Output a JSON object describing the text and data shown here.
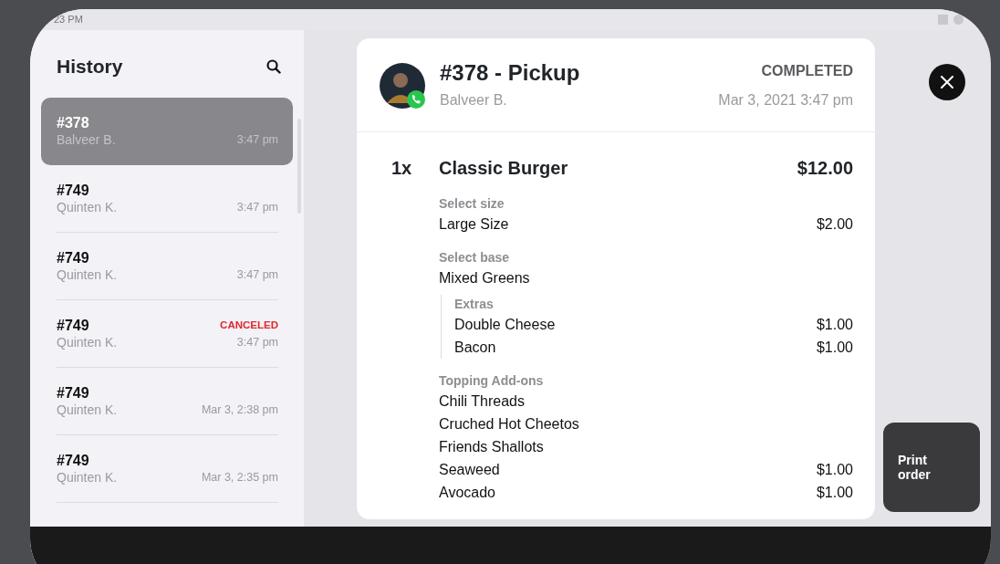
{
  "status_bar": {
    "time": "23 PM"
  },
  "sidebar": {
    "title": "History",
    "items": [
      {
        "number": "#378",
        "customer": "Balveer B.",
        "time": "3:47 pm",
        "selected": true
      },
      {
        "number": "#749",
        "customer": "Quinten K.",
        "time": "3:47 pm",
        "selected": false
      },
      {
        "number": "#749",
        "customer": "Quinten K.",
        "time": "3:47 pm",
        "selected": false
      },
      {
        "number": "#749",
        "customer": "Quinten K.",
        "time": "3:47 pm",
        "status": "CANCELED",
        "selected": false
      },
      {
        "number": "#749",
        "customer": "Quinten K.",
        "time": "Mar 3, 2:38 pm",
        "selected": false
      },
      {
        "number": "#749",
        "customer": "Quinten K.",
        "time": "Mar 3, 2:35 pm",
        "selected": false
      }
    ]
  },
  "order": {
    "title": "#378 - Pickup",
    "customer": "Balveer B.",
    "status": "COMPLETED",
    "date": "Mar 3, 2021 3:47 pm",
    "items": [
      {
        "quantity": "1x",
        "name": "Classic Burger",
        "price": "$12.00",
        "option_groups": [
          {
            "label": "Select size",
            "options": [
              {
                "name": "Large Size",
                "price": "$2.00"
              }
            ]
          },
          {
            "label": "Select base",
            "options": [
              {
                "name": "Mixed Greens"
              }
            ],
            "children": [
              {
                "label": "Extras",
                "options": [
                  {
                    "name": "Double Cheese",
                    "price": "$1.00"
                  },
                  {
                    "name": "Bacon",
                    "price": "$1.00"
                  }
                ]
              }
            ]
          },
          {
            "label": "Topping Add-ons",
            "options": [
              {
                "name": "Chili Threads"
              },
              {
                "name": "Cruched Hot Cheetos"
              },
              {
                "name": "Friends Shallots"
              },
              {
                "name": "Seaweed",
                "price": "$1.00"
              },
              {
                "name": "Avocado",
                "price": "$1.00"
              }
            ]
          }
        ]
      }
    ]
  },
  "print_button": {
    "label": "Print order"
  }
}
